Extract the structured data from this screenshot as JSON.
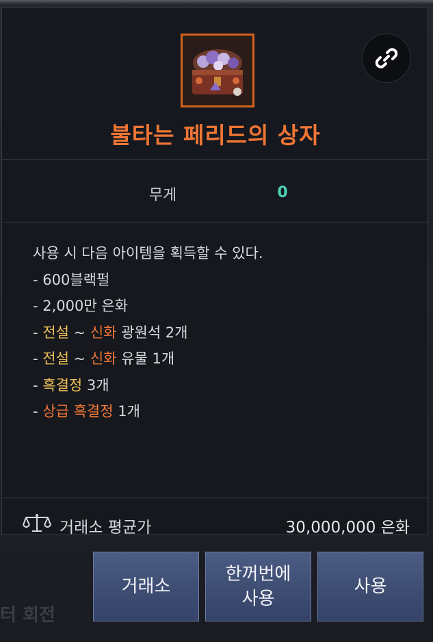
{
  "item": {
    "name": "불타는 페리드의 상자",
    "icon": "treasure-chest-icon",
    "link_icon": "link-icon"
  },
  "stats": {
    "weight_label": "무게",
    "weight_value": "0"
  },
  "description": {
    "intro": "사용 시 다음 아이템을 획득할 수 있다.",
    "lines": [
      {
        "segments": [
          {
            "text": "- 600블랙펄",
            "color": "default"
          }
        ]
      },
      {
        "segments": [
          {
            "text": "- 2,000만 은화",
            "color": "default"
          }
        ]
      },
      {
        "segments": [
          {
            "text": "- ",
            "color": "default"
          },
          {
            "text": "전설",
            "color": "gold"
          },
          {
            "text": " ~ ",
            "color": "default"
          },
          {
            "text": "신화",
            "color": "orange"
          },
          {
            "text": " 광원석 2개",
            "color": "default"
          }
        ]
      },
      {
        "segments": [
          {
            "text": "- ",
            "color": "default"
          },
          {
            "text": "전설",
            "color": "gold"
          },
          {
            "text": " ~ ",
            "color": "default"
          },
          {
            "text": "신화",
            "color": "orange"
          },
          {
            "text": " 유물 1개",
            "color": "default"
          }
        ]
      },
      {
        "segments": [
          {
            "text": "- ",
            "color": "default"
          },
          {
            "text": "흑결정",
            "color": "gold"
          },
          {
            "text": " 3개",
            "color": "default"
          }
        ]
      },
      {
        "segments": [
          {
            "text": "- ",
            "color": "default"
          },
          {
            "text": "상급 흑결정",
            "color": "orange"
          },
          {
            "text": " 1개",
            "color": "default"
          }
        ]
      }
    ]
  },
  "market": {
    "icon": "scale-icon",
    "label": "거래소 평균가",
    "price": "30,000,000 은화"
  },
  "buttons": {
    "market_label": "거래소",
    "use_all_label": "한꺼번에\n사용",
    "use_label": "사용"
  },
  "background": {
    "ghost_text": "터 회전"
  },
  "colors": {
    "title": "#f07634",
    "gold": "#f2c25a",
    "orange": "#f07634",
    "weight_value": "#4fd1b8",
    "button": "#3e4d72"
  }
}
